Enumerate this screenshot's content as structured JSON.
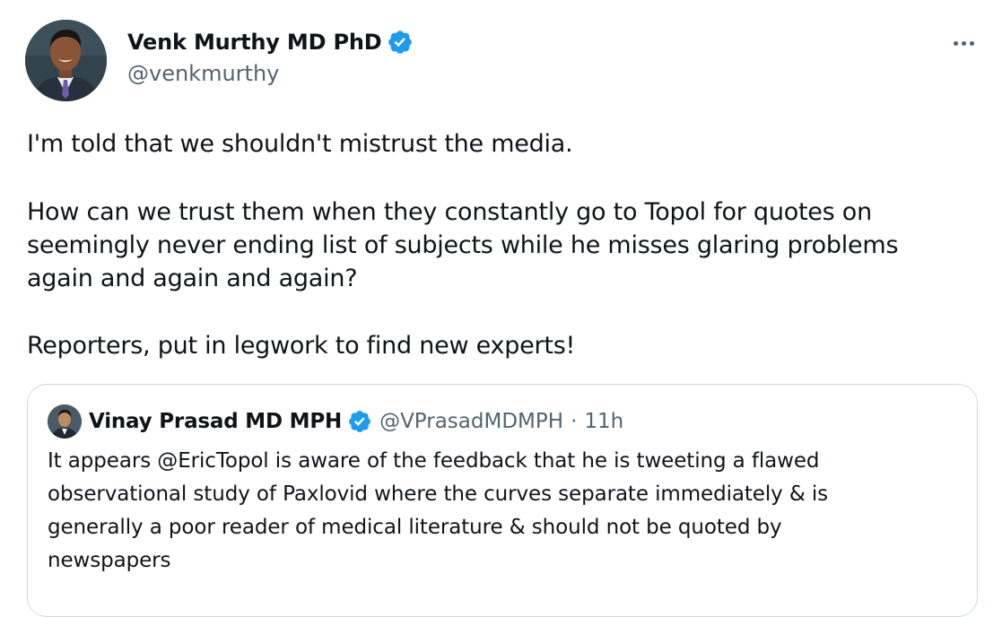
{
  "author": {
    "display_name": "Venk Murthy MD PhD",
    "handle": "@venkmurthy",
    "verified_icon": "verified-badge-icon",
    "verified_color": "#1d9bf0"
  },
  "menu": {
    "icon": "more-options-icon"
  },
  "tweet": {
    "lines": [
      "I'm told that we shouldn't mistrust the media.",
      "How can we trust them when they constantly go to Topol for quotes on",
      "seemingly never ending list of subjects while he misses glaring problems",
      "again and again and again?",
      "Reporters, put in legwork to find new experts!"
    ]
  },
  "quote": {
    "display_name": "Vinay Prasad MD MPH",
    "handle": "@VPrasadMDMPH",
    "separator": "·",
    "time": "11h",
    "lines": [
      "It appears @EricTopol is aware of the feedback that he is tweeting a flawed",
      "observational study of Paxlovid where the curves separate immediately & is",
      "generally a poor reader of medical literature & should not be quoted by",
      "newspapers"
    ]
  },
  "colors": {
    "text": "#0f1419",
    "secondary": "#536471",
    "border": "#cfd9de",
    "accent": "#1d9bf0"
  }
}
